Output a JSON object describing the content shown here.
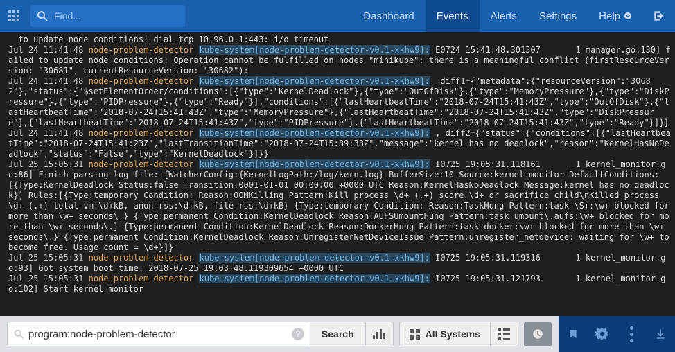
{
  "topbar": {
    "search_placeholder": "Find...",
    "nav": [
      {
        "label": "Dashboard",
        "active": false
      },
      {
        "label": "Events",
        "active": true
      },
      {
        "label": "Alerts",
        "active": false
      },
      {
        "label": "Settings",
        "active": false
      },
      {
        "label": "Help",
        "active": false,
        "has_dropdown": true
      }
    ]
  },
  "query_bar": {
    "value": "program:node-problem-detector",
    "search_button": "Search",
    "systems_button": "All Systems"
  },
  "log_entries": [
    {
      "ts": "",
      "program": "",
      "source": "",
      "body": "to update node conditions: dial tcp 10.96.0.1:443: i/o timeout",
      "continuation": true
    },
    {
      "ts": "Jul 24 11:41:48",
      "program": "node-problem-detector",
      "source": "kube-system[node-problem-detector-v0.1-xkhw9]:",
      "body": "E0724 15:41:48.301307       1 manager.go:130] failed to update node conditions: Operation cannot be fulfilled on nodes \"minikube\": there is a meaningful conflict (firstResourceVersion: \"30681\", currentResourceVersion: \"30682\"):"
    },
    {
      "ts": "Jul 24 11:41:48",
      "program": "node-problem-detector",
      "source": "kube-system[node-problem-detector-v0.1-xkhw9]:",
      "body": " diff1={\"metadata\":{\"resourceVersion\":\"30682\"},\"status\":{\"$setElementOrder/conditions\":[{\"type\":\"KernelDeadlock\"},{\"type\":\"OutOfDisk\"},{\"type\":\"MemoryPressure\"},{\"type\":\"DiskPressure\"},{\"type\":\"PIDPressure\"},{\"type\":\"Ready\"}],\"conditions\":[{\"lastHeartbeatTime\":\"2018-07-24T15:41:43Z\",\"type\":\"OutOfDisk\"},{\"lastHeartbeatTime\":\"2018-07-24T15:41:43Z\",\"type\":\"MemoryPressure\"},{\"lastHeartbeatTime\":\"2018-07-24T15:41:43Z\",\"type\":\"DiskPressure\"},{\"lastHeartbeatTime\":\"2018-07-24T15:41:43Z\",\"type\":\"PIDPressure\"},{\"lastHeartbeatTime\":\"2018-07-24T15:41:43Z\",\"type\":\"Ready\"}]}}"
    },
    {
      "ts": "Jul 24 11:41:48",
      "program": "node-problem-detector",
      "source": "kube-system[node-problem-detector-v0.1-xkhw9]:",
      "body": ", diff2={\"status\":{\"conditions\":[{\"lastHeartbeatTime\":\"2018-07-24T15:41:23Z\",\"lastTransitionTime\":\"2018-07-24T15:39:33Z\",\"message\":\"kernel has no deadlock\",\"reason\":\"KernelHasNoDeadlock\",\"status\":\"False\",\"type\":\"KernelDeadlock\"}]}}"
    },
    {
      "ts": "Jul 25 15:05:31",
      "program": "node-problem-detector",
      "source": "kube-system[node-problem-detector-v0.1-xkhw9]:",
      "body": "I0725 19:05:31.118161       1 kernel_monitor.go:86] Finish parsing log file: {WatcherConfig:{KernelLogPath:/log/kern.log} BufferSize:10 Source:kernel-monitor DefaultConditions:[{Type:KernelDeadlock Status:false Transition:0001-01-01 00:00:00 +0000 UTC Reason:KernelHasNoDeadlock Message:kernel has no deadlock}] Rules:[{Type:temporary Condition: Reason:OOMKilling Pattern:Kill process \\d+ (.+) score \\d+ or sacrifice child\\nKilled process \\d+ (.+) total-vm:\\d+kB, anon-rss:\\d+kB, file-rss:\\d+kB} {Type:temporary Condition: Reason:TaskHung Pattern:task \\S+:\\w+ blocked for more than \\w+ seconds\\.} {Type:permanent Condition:KernelDeadlock Reason:AUFSUmountHung Pattern:task umount\\.aufs:\\w+ blocked for more than \\w+ seconds\\.} {Type:permanent Condition:KernelDeadlock Reason:DockerHung Pattern:task docker:\\w+ blocked for more than \\w+ seconds\\.} {Type:permanent Condition:KernelDeadlock Reason:UnregisterNetDeviceIssue Pattern:unregister_netdevice: waiting for \\w+ to become free. Usage count = \\d+}]}"
    },
    {
      "ts": "Jul 25 15:05:31",
      "program": "node-problem-detector",
      "source": "kube-system[node-problem-detector-v0.1-xkhw9]:",
      "body": "I0725 19:05:31.119316       1 kernel_monitor.go:93] Got system boot time: 2018-07-25 19:03:48.119309654 +0000 UTC"
    },
    {
      "ts": "Jul 25 15:05:31",
      "program": "node-problem-detector",
      "source": "kube-system[node-problem-detector-v0.1-xkhw9]:",
      "body": "I0725 19:05:31.121793       1 kernel_monitor.go:102] Start kernel monitor"
    }
  ]
}
